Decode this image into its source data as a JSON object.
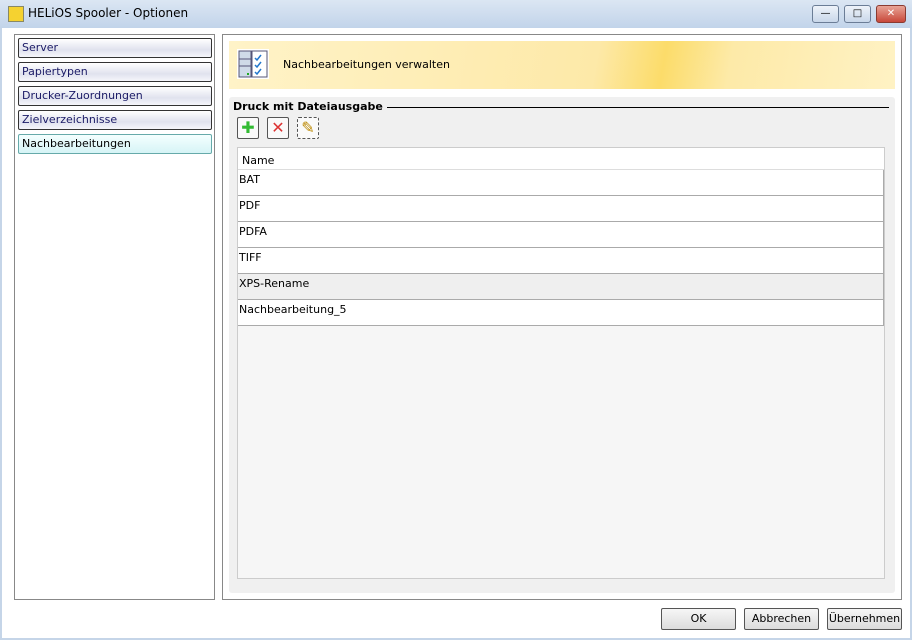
{
  "window": {
    "title": "HELiOS Spooler - Optionen",
    "minimize": "—",
    "maximize": "□",
    "close": "✕"
  },
  "sidebar": {
    "items": [
      {
        "label": "Server"
      },
      {
        "label": "Papiertypen"
      },
      {
        "label": "Drucker-Zuordnungen"
      },
      {
        "label": "Zielverzeichnisse"
      },
      {
        "label": "Nachbearbeitungen"
      }
    ],
    "active_index": 4
  },
  "banner": {
    "title": "Nachbearbeitungen verwalten"
  },
  "group": {
    "title": "Druck mit Dateiausgabe",
    "toolbar": {
      "add": "✚",
      "delete": "✕",
      "edit": "✎"
    }
  },
  "table": {
    "header": "Name",
    "rows": [
      "BAT",
      "PDF",
      "PDFA",
      "TIFF",
      "XPS-Rename",
      "Nachbearbeitung_5"
    ],
    "selected_index": 4
  },
  "buttons": {
    "ok": "OK",
    "cancel": "Abbrechen",
    "apply": "Übernehmen"
  },
  "colors": {
    "banner_accent": "#fcdc6a",
    "close_red": "#d0574a"
  }
}
